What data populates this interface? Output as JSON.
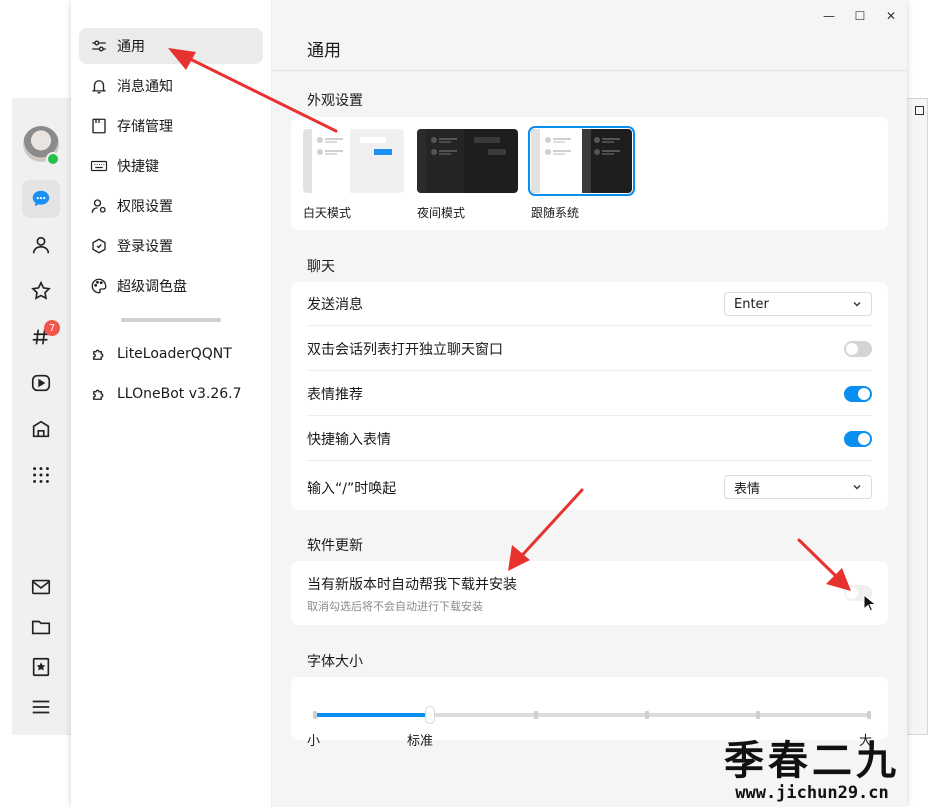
{
  "window": {
    "min_glyph": "—",
    "max_glyph": "☐",
    "close_glyph": "✕"
  },
  "rail": {
    "badge_count": "7",
    "icons": [
      "chat-icon",
      "contacts-icon",
      "favorites-icon",
      "channel-icon",
      "video-icon",
      "game-icon",
      "apps-grid-icon",
      "mail-icon",
      "folder-icon",
      "bookmark-icon",
      "menu-icon"
    ]
  },
  "sidebar": {
    "items": [
      {
        "label": "通用",
        "icon": "sliders-icon"
      },
      {
        "label": "消息通知",
        "icon": "bell-icon"
      },
      {
        "label": "存储管理",
        "icon": "storage-icon"
      },
      {
        "label": "快捷键",
        "icon": "keyboard-icon"
      },
      {
        "label": "权限设置",
        "icon": "user-lock-icon"
      },
      {
        "label": "登录设置",
        "icon": "shield-icon"
      },
      {
        "label": "超级调色盘",
        "icon": "palette-icon"
      }
    ],
    "plugins": [
      {
        "label": "LiteLoaderQQNT",
        "icon": "puzzle-icon"
      },
      {
        "label": "LLOneBot v3.26.7",
        "icon": "puzzle-icon"
      }
    ]
  },
  "main": {
    "title": "通用",
    "appearance": {
      "title": "外观设置",
      "themes": [
        {
          "label": "白天模式"
        },
        {
          "label": "夜间模式"
        },
        {
          "label": "跟随系统"
        }
      ],
      "selected": 2
    },
    "chat": {
      "title": "聊天",
      "send_label": "发送消息",
      "send_value": "Enter",
      "open_window_label": "双击会话列表打开独立聊天窗口",
      "sticker_suggest_label": "表情推荐",
      "quick_sticker_label": "快捷输入表情",
      "slash_label": "输入“/”时唤起",
      "slash_value": "表情",
      "toggles": {
        "open_window": false,
        "sticker_suggest": true,
        "quick_sticker": true
      }
    },
    "update": {
      "title": "软件更新",
      "auto_label": "当有新版本时自动帮我下载并安装",
      "auto_desc": "取消勾选后将不会自动进行下载安装",
      "auto_on": false
    },
    "font": {
      "title": "字体大小",
      "min_label": "小",
      "std_label": "标准",
      "max_label": "大",
      "level": 1,
      "steps": 6
    }
  },
  "watermark": {
    "main": "季春二九",
    "url": "www.jichun29.cn"
  },
  "colors": {
    "accent": "#0a8ef0",
    "annotation": "#e8322f"
  }
}
